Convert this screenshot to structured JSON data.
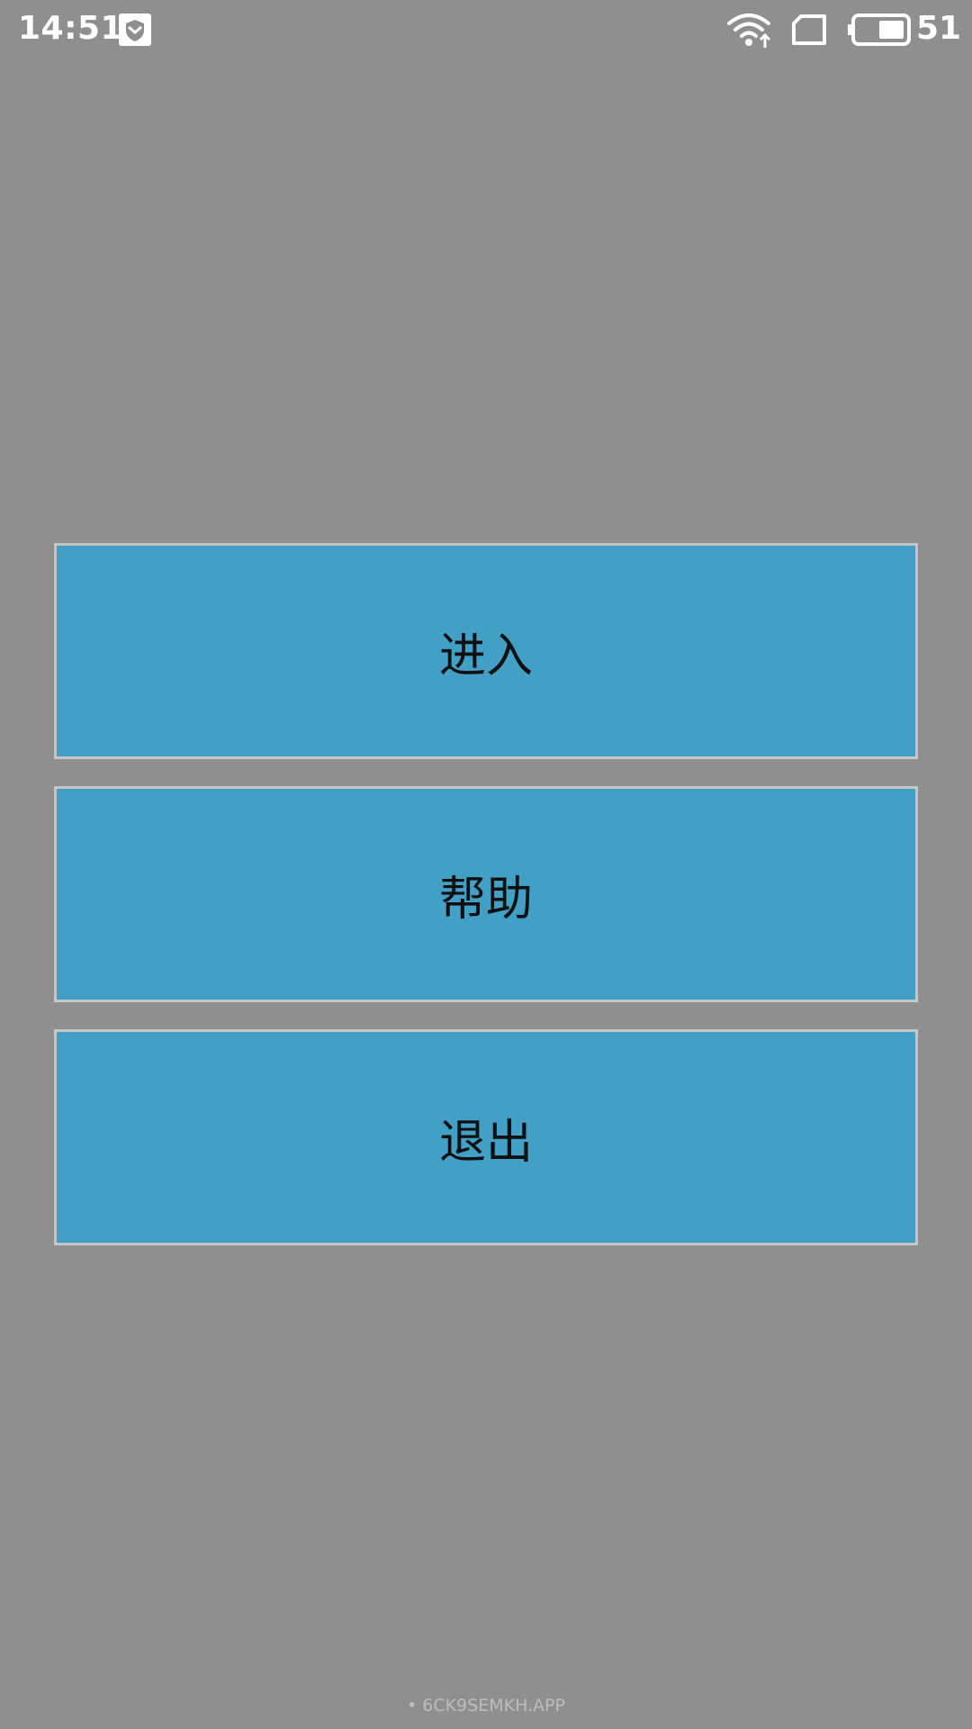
{
  "status_bar": {
    "time": "14:51",
    "battery_level": "51",
    "icons": [
      "shield-icon",
      "wifi-icon",
      "sim-card-icon",
      "battery-icon"
    ]
  },
  "menu": {
    "enter_label": "进入",
    "help_label": "帮助",
    "exit_label": "退出"
  },
  "footer": {
    "watermark": "• 6CK9SEMKH.APP"
  },
  "colors": {
    "background": "#8f8f8f",
    "button_fill": "#429fc6",
    "button_border": "#c6c6c6",
    "button_text": "#101010"
  }
}
